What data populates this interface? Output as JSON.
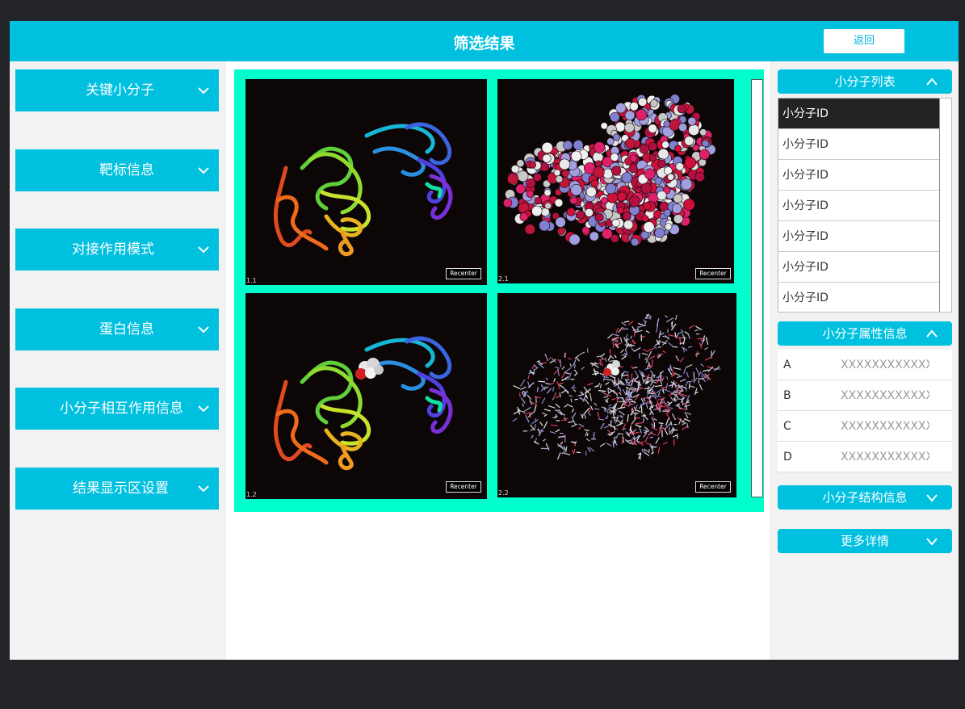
{
  "header": {
    "title": "筛选结果",
    "back_label": "返回"
  },
  "left_menu": [
    {
      "label": "关键小分子"
    },
    {
      "label": "靶标信息"
    },
    {
      "label": "对接作用模式"
    },
    {
      "label": "蛋白信息"
    },
    {
      "label": "小分子相互作用信息"
    },
    {
      "label": "结果显示区设置"
    }
  ],
  "viewports": [
    {
      "label": "1.1",
      "style": "ribbon",
      "recenter_label": "Recenter"
    },
    {
      "label": "2.1",
      "style": "spacefill",
      "recenter_label": "Recenter"
    },
    {
      "label": "1.2",
      "style": "ribbon-ligand",
      "recenter_label": "Recenter"
    },
    {
      "label": "2.2",
      "style": "sticks",
      "recenter_label": "Recenter"
    }
  ],
  "right": {
    "list_header": "小分子列表",
    "list_items": [
      "小分子ID",
      "小分子ID",
      "小分子ID",
      "小分子ID",
      "小分子ID",
      "小分子ID",
      "小分子ID"
    ],
    "selected_index": 0,
    "attr_header": "小分子属性信息",
    "attrs": [
      {
        "key": "A",
        "value": "XXXXXXXXXXXX"
      },
      {
        "key": "B",
        "value": "XXXXXXXXXXXX"
      },
      {
        "key": "C",
        "value": "XXXXXXXXXXXX"
      },
      {
        "key": "D",
        "value": "XXXXXXXXXXXX"
      }
    ],
    "structure_header": "小分子结构信息",
    "more_header": "更多详情"
  },
  "colors": {
    "accent": "#00c0e0",
    "viewer_bg": "#00ffcc",
    "viewport_bg": "#0c0607"
  }
}
